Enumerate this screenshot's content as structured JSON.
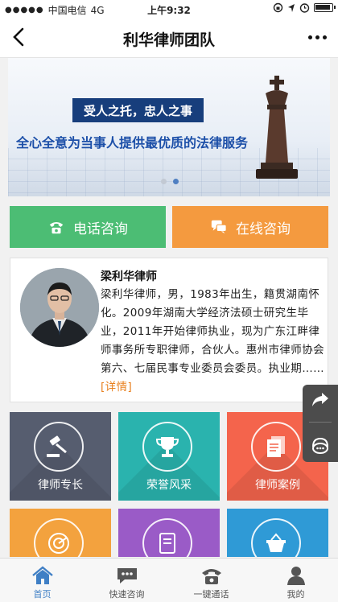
{
  "status_bar": {
    "carrier": "中国电信",
    "network": "4G",
    "time": "上午9:32"
  },
  "nav": {
    "title": "利华律师团队"
  },
  "banner": {
    "slogan": "受人之托，忠人之事",
    "mission": "全心全意为当事人提供最优质的法律服务",
    "slide_count": 2,
    "active_slide": 2
  },
  "consult": {
    "phone_label": "电话咨询",
    "online_label": "在线咨询"
  },
  "lawyer": {
    "name": "梁利华律师",
    "bio": "梁利华律师，男，1983年出生，籍贯湖南怀化。2009年湖南大学经济法硕士研究生毕业，2011年开始律师执业，现为广东江畔律师事务所专职律师，合伙人。惠州市律师协会第六、七届民事专业委员会委员。执业期……",
    "more_label": "[详情]"
  },
  "tiles": [
    {
      "label": "律师专长",
      "icon": "gavel-icon",
      "color": "#565d6f"
    },
    {
      "label": "荣誉风采",
      "icon": "trophy-icon",
      "color": "#2ab3ae"
    },
    {
      "label": "律师案例",
      "icon": "documents-icon",
      "color": "#f4644c"
    },
    {
      "label": "",
      "icon": "radar-icon",
      "color": "#f3a23e"
    },
    {
      "label": "",
      "icon": "notebook-icon",
      "color": "#9a5bc7"
    },
    {
      "label": "",
      "icon": "basket-icon",
      "color": "#2f9ad6"
    }
  ],
  "tabbar": {
    "items": [
      {
        "label": "首页",
        "icon": "home-icon",
        "active": true
      },
      {
        "label": "快速咨询",
        "icon": "chat-icon",
        "active": false
      },
      {
        "label": "一键通话",
        "icon": "telephone-icon",
        "active": false
      },
      {
        "label": "我的",
        "icon": "user-icon",
        "active": false
      }
    ]
  },
  "colors": {
    "phone_button": "#4cbd74",
    "online_button": "#f49a3f",
    "accent": "#3f7fc5",
    "link": "#e8801e"
  }
}
